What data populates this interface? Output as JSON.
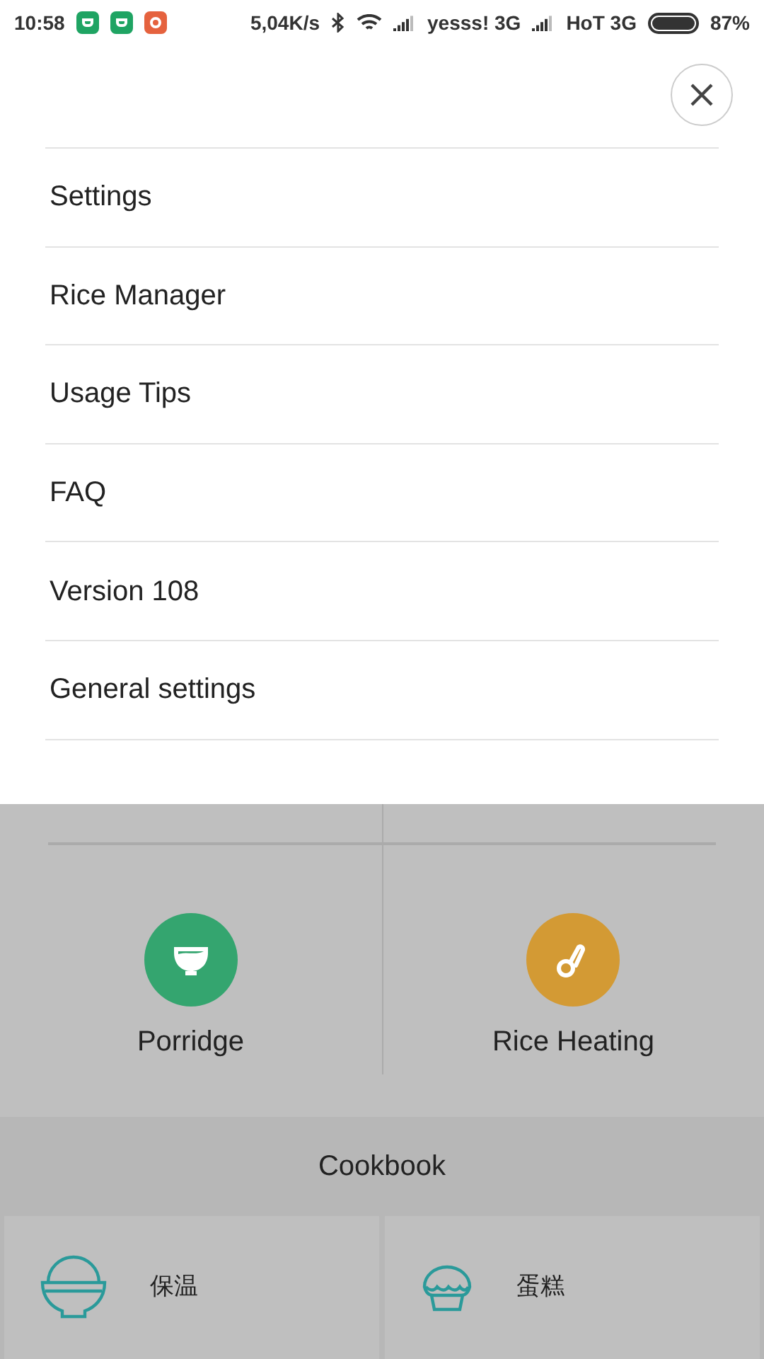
{
  "status_bar": {
    "time": "10:58",
    "notifications": [
      {
        "kind": "app",
        "color": "#1fa463"
      },
      {
        "kind": "app",
        "color": "#1fa463"
      },
      {
        "kind": "record",
        "color": "#e5623e"
      }
    ],
    "speed": "5,04K/s",
    "carrier_1": "yesss! 3G",
    "carrier_2": "HoT 3G",
    "battery": "87%"
  },
  "menu": {
    "items": [
      "Settings",
      "Rice Manager",
      "Usage Tips",
      "FAQ",
      "Version 108",
      "General settings"
    ]
  },
  "modes": [
    {
      "kind": "bowl",
      "label": "Porridge",
      "color": "#34a56f"
    },
    {
      "kind": "spoon",
      "label": "Rice Heating",
      "color": "#d39a34"
    }
  ],
  "cookbook": {
    "title": "Cookbook",
    "recipes": [
      {
        "kind": "rice",
        "label": "保温"
      },
      {
        "kind": "cake",
        "label": "蛋糕"
      }
    ]
  }
}
